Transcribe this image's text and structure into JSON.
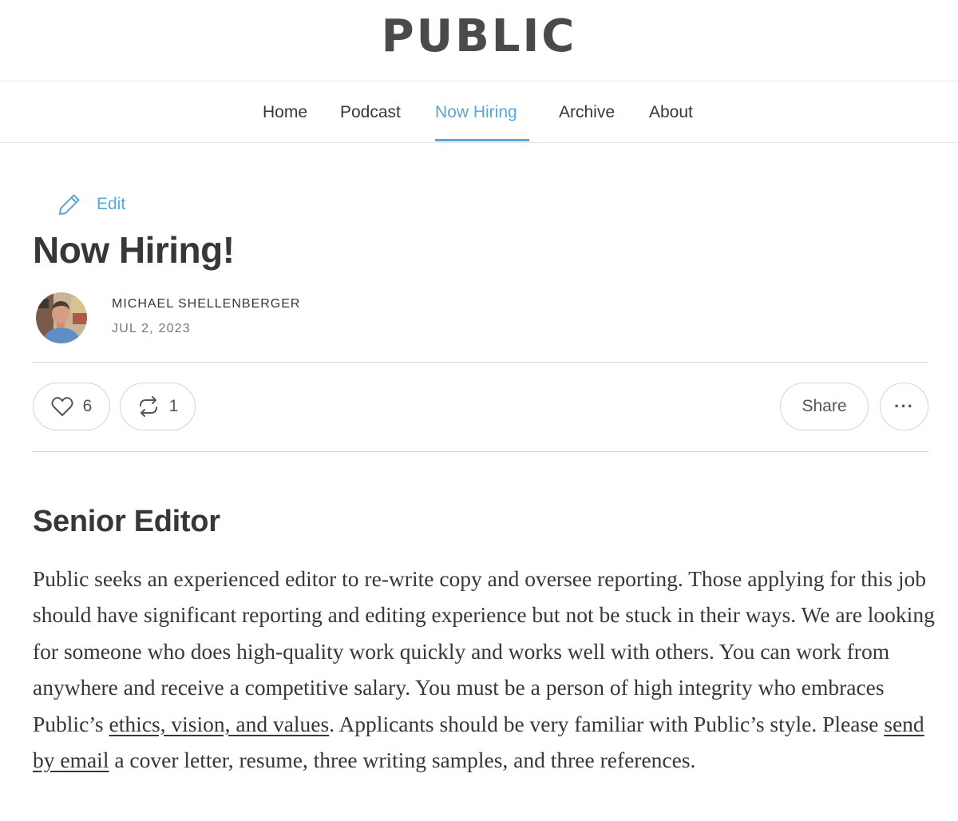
{
  "site": {
    "logo_text": "PUBLIC"
  },
  "nav": {
    "items": [
      {
        "label": "Home"
      },
      {
        "label": "Podcast"
      },
      {
        "label": "Now Hiring",
        "active": true
      },
      {
        "label": "Archive"
      },
      {
        "label": "About"
      }
    ]
  },
  "post": {
    "edit_label": "Edit",
    "title": "Now Hiring!",
    "author": "MICHAEL SHELLENBERGER",
    "date": "JUL 2, 2023",
    "like_count": "6",
    "restack_count": "1",
    "share_label": "Share",
    "more_label": "···"
  },
  "content": {
    "heading": "Senior Editor",
    "paragraph_part1": "Public seeks an experienced editor to re-write copy and oversee reporting. Those applying for this job should have significant reporting and editing experience but not be stuck in their ways. We are looking for someone who does high-quality work quickly and works well with others. You can work from anywhere and receive a competitive salary. You must be a person of high integrity who embraces Public’s ",
    "link_values": "ethics, vision, and values",
    "paragraph_part2": ". Applicants should be very familiar with Public’s style. Please ",
    "link_email": "send by email",
    "paragraph_part3": " a cover letter, resume, three writing samples, and three references."
  },
  "colors": {
    "accent": "#5ba6d8",
    "text": "#363737",
    "muted": "#757575",
    "border": "#d4d4d4"
  },
  "icons": {
    "edit": "pencil-icon",
    "like": "heart-icon",
    "restack": "restack-icon",
    "more": "ellipsis-icon"
  }
}
